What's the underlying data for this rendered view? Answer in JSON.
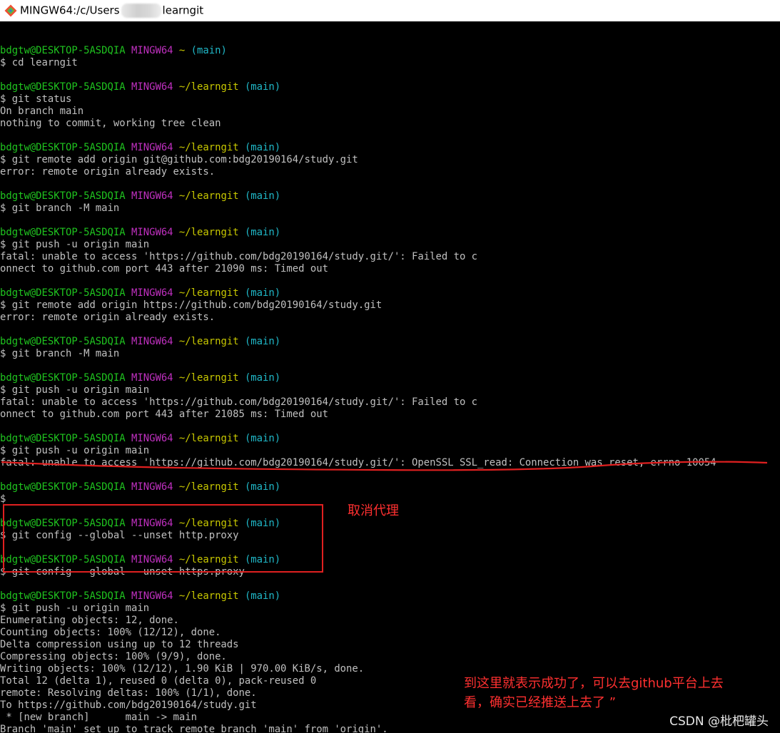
{
  "window": {
    "title_prefix": "MINGW64:/c/Users",
    "title_suffix": "learngit"
  },
  "colors": {
    "user": "#1fc41f",
    "mingw": "#c030c0",
    "path": "#c8c800",
    "branch": "#20b8c8",
    "text": "#c0c0c0",
    "annotation": "#ff3030"
  },
  "terminal": {
    "lines": [
      {
        "type": "blank"
      },
      {
        "type": "prompt",
        "user": "bdgtw@DESKTOP-5ASDQIA",
        "env": "MINGW64",
        "path": "~",
        "branch": "(main)"
      },
      {
        "type": "text",
        "text": "$ cd learngit"
      },
      {
        "type": "blank"
      },
      {
        "type": "prompt",
        "user": "bdgtw@DESKTOP-5ASDQIA",
        "env": "MINGW64",
        "path": "~/learngit",
        "branch": "(main)"
      },
      {
        "type": "text",
        "text": "$ git status"
      },
      {
        "type": "text",
        "text": "On branch main"
      },
      {
        "type": "text",
        "text": "nothing to commit, working tree clean"
      },
      {
        "type": "blank"
      },
      {
        "type": "prompt",
        "user": "bdgtw@DESKTOP-5ASDQIA",
        "env": "MINGW64",
        "path": "~/learngit",
        "branch": "(main)"
      },
      {
        "type": "text",
        "text": "$ git remote add origin git@github.com:bdg20190164/study.git"
      },
      {
        "type": "text",
        "text": "error: remote origin already exists."
      },
      {
        "type": "blank"
      },
      {
        "type": "prompt",
        "user": "bdgtw@DESKTOP-5ASDQIA",
        "env": "MINGW64",
        "path": "~/learngit",
        "branch": "(main)"
      },
      {
        "type": "text",
        "text": "$ git branch -M main"
      },
      {
        "type": "blank"
      },
      {
        "type": "prompt",
        "user": "bdgtw@DESKTOP-5ASDQIA",
        "env": "MINGW64",
        "path": "~/learngit",
        "branch": "(main)"
      },
      {
        "type": "text",
        "text": "$ git push -u origin main"
      },
      {
        "type": "text",
        "text": "fatal: unable to access 'https://github.com/bdg20190164/study.git/': Failed to c"
      },
      {
        "type": "text",
        "text": "onnect to github.com port 443 after 21090 ms: Timed out"
      },
      {
        "type": "blank"
      },
      {
        "type": "prompt",
        "user": "bdgtw@DESKTOP-5ASDQIA",
        "env": "MINGW64",
        "path": "~/learngit",
        "branch": "(main)"
      },
      {
        "type": "text",
        "text": "$ git remote add origin https://github.com/bdg20190164/study.git"
      },
      {
        "type": "text",
        "text": "error: remote origin already exists."
      },
      {
        "type": "blank"
      },
      {
        "type": "prompt",
        "user": "bdgtw@DESKTOP-5ASDQIA",
        "env": "MINGW64",
        "path": "~/learngit",
        "branch": "(main)"
      },
      {
        "type": "text",
        "text": "$ git branch -M main"
      },
      {
        "type": "blank"
      },
      {
        "type": "prompt",
        "user": "bdgtw@DESKTOP-5ASDQIA",
        "env": "MINGW64",
        "path": "~/learngit",
        "branch": "(main)"
      },
      {
        "type": "text",
        "text": "$ git push -u origin main"
      },
      {
        "type": "text",
        "text": "fatal: unable to access 'https://github.com/bdg20190164/study.git/': Failed to c"
      },
      {
        "type": "text",
        "text": "onnect to github.com port 443 after 21085 ms: Timed out"
      },
      {
        "type": "blank"
      },
      {
        "type": "prompt",
        "user": "bdgtw@DESKTOP-5ASDQIA",
        "env": "MINGW64",
        "path": "~/learngit",
        "branch": "(main)"
      },
      {
        "type": "text",
        "text": "$ git push -u origin main"
      },
      {
        "type": "text",
        "text": "fatal: unable to access 'https://github.com/bdg20190164/study.git/': OpenSSL SSL_read: Connection was reset, errno 10054"
      },
      {
        "type": "blank"
      },
      {
        "type": "prompt",
        "user": "bdgtw@DESKTOP-5ASDQIA",
        "env": "MINGW64",
        "path": "~/learngit",
        "branch": "(main)"
      },
      {
        "type": "text",
        "text": "$"
      },
      {
        "type": "blank"
      },
      {
        "type": "prompt",
        "user": "bdgtw@DESKTOP-5ASDQIA",
        "env": "MINGW64",
        "path": "~/learngit",
        "branch": "(main)"
      },
      {
        "type": "text",
        "text": "$ git config --global --unset http.proxy"
      },
      {
        "type": "blank"
      },
      {
        "type": "prompt",
        "user": "bdgtw@DESKTOP-5ASDQIA",
        "env": "MINGW64",
        "path": "~/learngit",
        "branch": "(main)"
      },
      {
        "type": "text",
        "text": "$ git config --global --unset https.proxy"
      },
      {
        "type": "blank"
      },
      {
        "type": "prompt",
        "user": "bdgtw@DESKTOP-5ASDQIA",
        "env": "MINGW64",
        "path": "~/learngit",
        "branch": "(main)"
      },
      {
        "type": "text",
        "text": "$ git push -u origin main"
      },
      {
        "type": "text",
        "text": "Enumerating objects: 12, done."
      },
      {
        "type": "text",
        "text": "Counting objects: 100% (12/12), done."
      },
      {
        "type": "text",
        "text": "Delta compression using up to 12 threads"
      },
      {
        "type": "text",
        "text": "Compressing objects: 100% (9/9), done."
      },
      {
        "type": "text",
        "text": "Writing objects: 100% (12/12), 1.90 KiB | 970.00 KiB/s, done."
      },
      {
        "type": "text",
        "text": "Total 12 (delta 1), reused 0 (delta 0), pack-reused 0"
      },
      {
        "type": "text",
        "text": "remote: Resolving deltas: 100% (1/1), done."
      },
      {
        "type": "text",
        "text": "To https://github.com/bdg20190164/study.git"
      },
      {
        "type": "text",
        "text": " * [new branch]      main -> main"
      },
      {
        "type": "text",
        "text": "Branch 'main' set up to track remote branch 'main' from 'origin'."
      }
    ]
  },
  "annotations": {
    "cancel_proxy": "取消代理",
    "success": "到这里就表示成功了，可以去github平台上去\n看，确实已经推送上去了 ”"
  },
  "watermark": "CSDN @枇杷罐头"
}
